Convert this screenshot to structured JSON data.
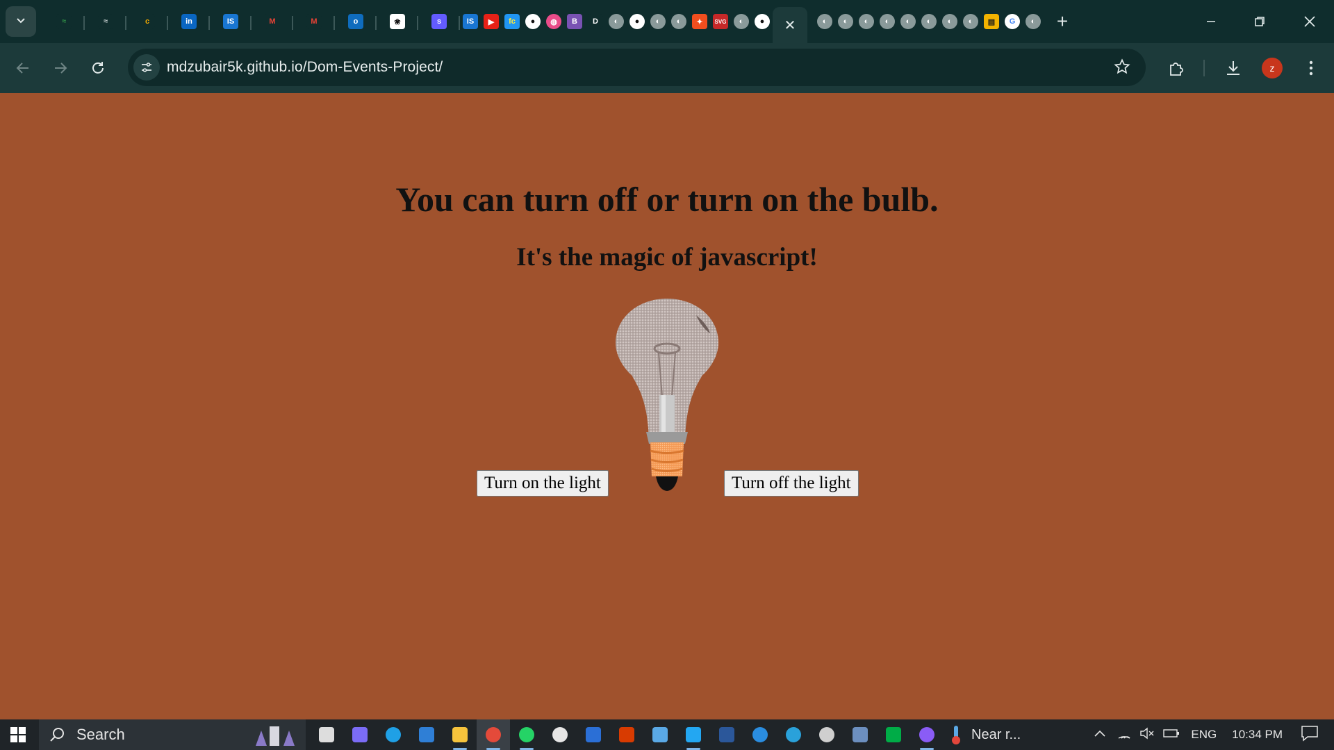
{
  "browser": {
    "url": "mdzubair5k.github.io/Dom-Events-Project/",
    "profile_initial": "z",
    "tabs": [
      {
        "icon": "geeksforgeeks-icon",
        "glyph": "≈",
        "bg": "#0f2d2d",
        "color": "#2f8d46"
      },
      {
        "icon": "geeksforgeeks-icon",
        "glyph": "≈",
        "bg": "#0f2d2d",
        "color": "#bfc9c9"
      },
      {
        "icon": "coursera-icon",
        "glyph": "c",
        "bg": "#0f2d2d",
        "color": "#f2a900"
      },
      {
        "icon": "linkedin-icon",
        "glyph": "in",
        "bg": "#0a66c2",
        "color": "#ffffff"
      },
      {
        "icon": "is-icon",
        "glyph": "IS",
        "bg": "#1976d2",
        "color": "#ffffff"
      },
      {
        "icon": "gmail-icon",
        "glyph": "M",
        "bg": "#0f2d2d",
        "color": "#ea4335"
      },
      {
        "icon": "gmail-icon",
        "glyph": "M",
        "bg": "#0f2d2d",
        "color": "#ea4335"
      },
      {
        "icon": "outlook-icon",
        "glyph": "o",
        "bg": "#0f6cbd",
        "color": "#ffffff"
      },
      {
        "icon": "chatgpt-icon",
        "glyph": "❀",
        "bg": "#ffffff",
        "color": "#111111"
      },
      {
        "icon": "stripe-icon",
        "glyph": "s",
        "bg": "#635bff",
        "color": "#ffffff"
      }
    ],
    "mini_tabs": [
      {
        "icon": "is-icon",
        "glyph": "IS",
        "bg": "#1976d2",
        "color": "#fff"
      },
      {
        "icon": "youtube-icon",
        "glyph": "▶",
        "bg": "#e62117",
        "color": "#fff"
      },
      {
        "icon": "freecodecamp-icon",
        "glyph": "fc",
        "bg": "#2196f3",
        "color": "#ffeb3b"
      },
      {
        "icon": "github-icon",
        "glyph": "●",
        "bg": "#ffffff",
        "color": "#111"
      },
      {
        "icon": "dribbble-icon",
        "glyph": "◍",
        "bg": "#ea4c89",
        "color": "#fff"
      },
      {
        "icon": "bootstrap-icon",
        "glyph": "B",
        "bg": "#7952b3",
        "color": "#fff"
      },
      {
        "icon": "d-icon",
        "glyph": "D",
        "bg": "#0f2d2d",
        "color": "#fff"
      },
      {
        "icon": "globe-icon",
        "glyph": "◐",
        "bg": "#8a9a9a",
        "color": "#fff"
      },
      {
        "icon": "github-icon",
        "glyph": "●",
        "bg": "#ffffff",
        "color": "#111"
      },
      {
        "icon": "globe-icon",
        "glyph": "◐",
        "bg": "#8a9a9a",
        "color": "#fff"
      },
      {
        "icon": "globe-icon",
        "glyph": "◐",
        "bg": "#8a9a9a",
        "color": "#fff"
      },
      {
        "icon": "figma-icon",
        "glyph": "✦",
        "bg": "#f24e1e",
        "color": "#fff"
      },
      {
        "icon": "svg-png-icon",
        "glyph": "SVG",
        "bg": "#c62828",
        "color": "#fff"
      },
      {
        "icon": "globe-icon",
        "glyph": "◐",
        "bg": "#8a9a9a",
        "color": "#fff"
      },
      {
        "icon": "github-icon",
        "glyph": "●",
        "bg": "#ffffff",
        "color": "#111"
      }
    ],
    "after_tabs": [
      {
        "icon": "globe-icon",
        "glyph": "◐",
        "bg": "#8a9a9a",
        "color": "#fff"
      },
      {
        "icon": "globe-icon",
        "glyph": "◐",
        "bg": "#8a9a9a",
        "color": "#fff"
      },
      {
        "icon": "globe-icon",
        "glyph": "◐",
        "bg": "#8a9a9a",
        "color": "#fff"
      },
      {
        "icon": "globe-icon",
        "glyph": "◐",
        "bg": "#8a9a9a",
        "color": "#fff"
      },
      {
        "icon": "globe-icon",
        "glyph": "◐",
        "bg": "#8a9a9a",
        "color": "#fff"
      },
      {
        "icon": "globe-icon",
        "glyph": "◐",
        "bg": "#8a9a9a",
        "color": "#fff"
      },
      {
        "icon": "globe-icon",
        "glyph": "◐",
        "bg": "#8a9a9a",
        "color": "#fff"
      },
      {
        "icon": "globe-icon",
        "glyph": "◐",
        "bg": "#8a9a9a",
        "color": "#fff"
      },
      {
        "icon": "classroom-icon",
        "glyph": "▤",
        "bg": "#f4b400",
        "color": "#1a1a1a"
      },
      {
        "icon": "google-icon",
        "glyph": "G",
        "bg": "#ffffff",
        "color": "#4285f4"
      },
      {
        "icon": "globe-icon",
        "glyph": "◐",
        "bg": "#8a9a9a",
        "color": "#fff"
      }
    ]
  },
  "page": {
    "title": "You can turn off or turn on the bulb.",
    "subtitle": "It's the magic of javascript!",
    "btn_on": "Turn on the light",
    "btn_off": "Turn off the light",
    "bg_color": "#a0522d"
  },
  "taskbar": {
    "search_placeholder": "Search",
    "weather": "Near r...",
    "language": "ENG",
    "time": "10:34 PM",
    "apps": [
      {
        "icon": "task-view-icon",
        "color": "#dddddd",
        "running": false
      },
      {
        "icon": "copilot-icon",
        "color": "#7b6cf6",
        "running": false
      },
      {
        "icon": "edge-icon",
        "color": "#1fa0e6",
        "running": false
      },
      {
        "icon": "store-icon",
        "color": "#2f7fd6",
        "running": false
      },
      {
        "icon": "file-explorer-icon",
        "color": "#f6c33c",
        "running": true
      },
      {
        "icon": "chrome-icon",
        "color": "#e44a3a",
        "running": true,
        "active": true
      },
      {
        "icon": "whatsapp-icon",
        "color": "#25d366",
        "running": true
      },
      {
        "icon": "settings-icon",
        "color": "#e6e6e6",
        "running": false
      },
      {
        "icon": "dev-icon",
        "color": "#2b6fd6",
        "running": false
      },
      {
        "icon": "office-icon",
        "color": "#d83b01",
        "running": false
      },
      {
        "icon": "notes-icon",
        "color": "#5aa9e6",
        "running": false
      },
      {
        "icon": "vscode-icon",
        "color": "#23a7f2",
        "running": true
      },
      {
        "icon": "word-icon",
        "color": "#2b579a",
        "running": false
      },
      {
        "icon": "edge-dev-icon",
        "color": "#2a8de0",
        "running": false
      },
      {
        "icon": "telegram-icon",
        "color": "#2aa1da",
        "running": false
      },
      {
        "icon": "clock-icon",
        "color": "#cfcfcf",
        "running": false
      },
      {
        "icon": "calculator-icon",
        "color": "#6c8fbf",
        "running": false
      },
      {
        "icon": "meet-icon",
        "color": "#00ac47",
        "running": false
      },
      {
        "icon": "github-desktop-icon",
        "color": "#8a5cf6",
        "running": true
      }
    ]
  }
}
